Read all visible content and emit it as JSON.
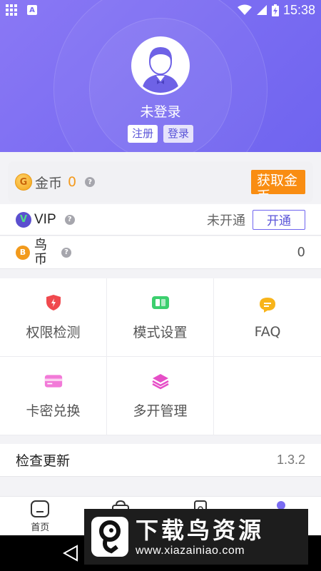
{
  "status_bar": {
    "time": "15:38",
    "notif_letter": "A"
  },
  "header": {
    "username": "未登录",
    "register_label": "注册",
    "login_label": "登录"
  },
  "coins": {
    "icon_letter": "G",
    "label": "金币",
    "value": "0",
    "help": "?",
    "get_button": "获取金币"
  },
  "vip": {
    "icon_letter": "V",
    "label": "VIP",
    "help": "?",
    "status": "未开通",
    "open_button": "开通"
  },
  "bird_coin": {
    "icon_letter": "B",
    "label": "鸟币",
    "help": "?",
    "value": "0"
  },
  "tools": [
    {
      "label": "权限检测",
      "icon": "shield-icon"
    },
    {
      "label": "模式设置",
      "icon": "mode-icon"
    },
    {
      "label": "FAQ",
      "icon": "chat-bubble-icon"
    },
    {
      "label": "卡密兑换",
      "icon": "card-icon"
    },
    {
      "label": "多开管理",
      "icon": "layers-icon"
    }
  ],
  "update": {
    "label": "检查更新",
    "version": "1.3.2"
  },
  "tabbar": {
    "home_label": "首页"
  },
  "watermark": {
    "title": "下载鸟资源",
    "url": "www.xiazainiao.com"
  },
  "colors": {
    "header": "#7a6cf2",
    "accent_orange": "#f98d12",
    "coin_value": "#f39a1e",
    "vip_border": "#6f64ef"
  }
}
